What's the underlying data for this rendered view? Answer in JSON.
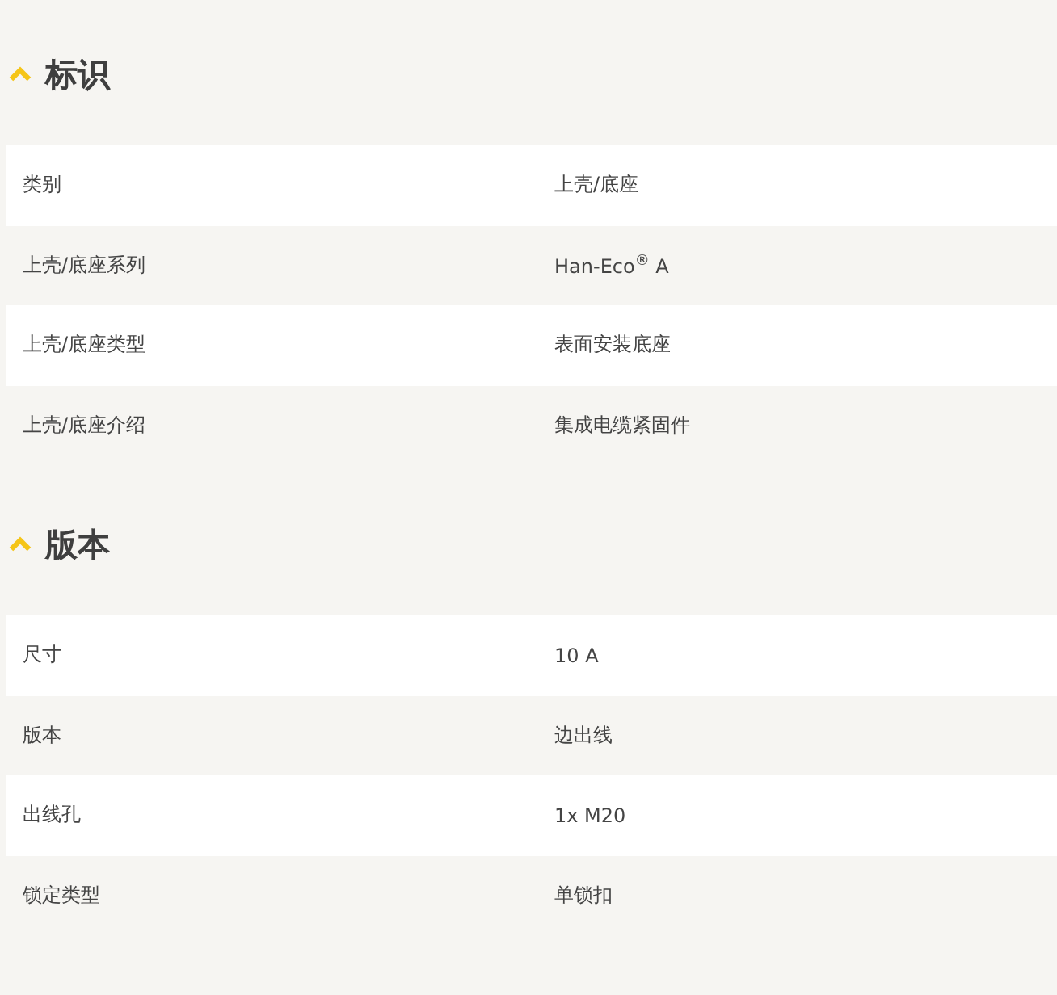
{
  "sections": [
    {
      "title": "标识",
      "expanded": true,
      "rows": [
        {
          "label": "类别",
          "value": "上壳/底座"
        },
        {
          "label": "上壳/底座系列",
          "value": "Han-Eco$^{®}$ A"
        },
        {
          "label": "上壳/底座类型",
          "value": "表面安装底座"
        },
        {
          "label": "上壳/底座介绍",
          "value": "集成电缆紧固件"
        }
      ]
    },
    {
      "title": "版本",
      "expanded": true,
      "rows": [
        {
          "label": "尺寸",
          "value": "10 A"
        },
        {
          "label": "版本",
          "value": "边出线"
        },
        {
          "label": "出线孔",
          "value": "1x M20"
        },
        {
          "label": "锁定类型",
          "value": "单锁扣"
        }
      ]
    }
  ]
}
